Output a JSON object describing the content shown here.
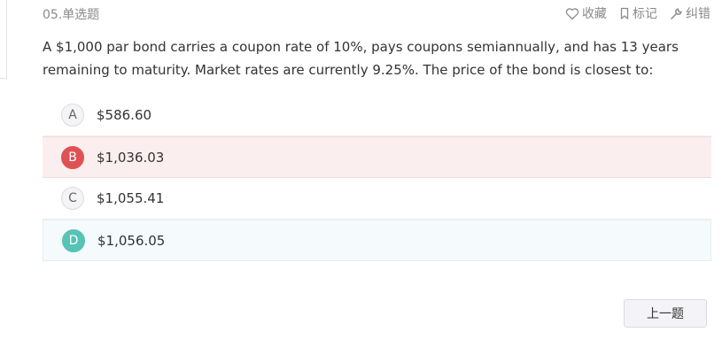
{
  "question": {
    "type_label": "05.单选题",
    "text": "A $1,000 par bond carries a coupon rate of 10%, pays coupons semiannually, and has 13 years remaining to maturity. Market rates are currently 9.25%. The price of the bond is closest to:"
  },
  "actions": {
    "favorite": {
      "label": "收藏",
      "icon": "heart-icon"
    },
    "mark": {
      "label": "标记",
      "icon": "bookmark-icon"
    },
    "report": {
      "label": "纠错",
      "icon": "wrench-icon"
    }
  },
  "options": [
    {
      "letter": "A",
      "text": "$586.60",
      "state": "normal"
    },
    {
      "letter": "B",
      "text": "$1,036.03",
      "state": "wrong"
    },
    {
      "letter": "C",
      "text": "$1,055.41",
      "state": "normal"
    },
    {
      "letter": "D",
      "text": "$1,056.05",
      "state": "correct"
    }
  ],
  "colors": {
    "wrong": "#df5254",
    "correct": "#56c3b5",
    "wrong_bg": "#fbeeee",
    "correct_bg": "#f5fafd"
  },
  "nav": {
    "prev_label": "上一题"
  }
}
